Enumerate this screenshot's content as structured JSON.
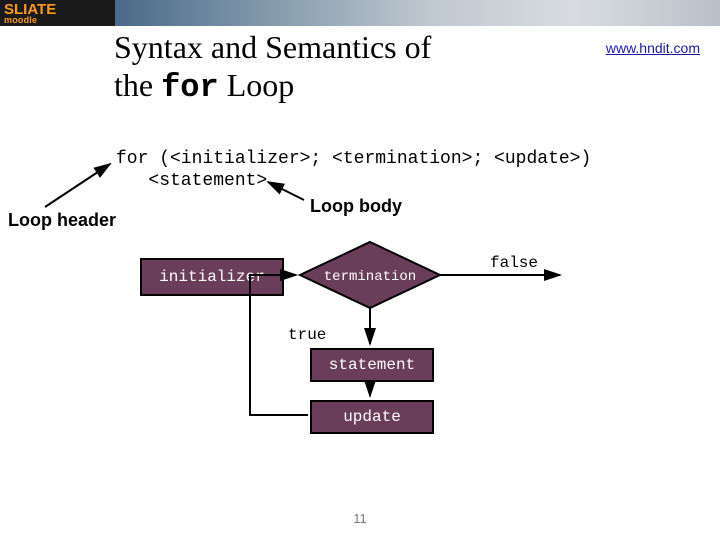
{
  "brand": {
    "line1a": "SLIATE",
    "line1b": "",
    "sub": "moodle"
  },
  "title": {
    "p1": "Syntax and Semantics of",
    "p2a": "the ",
    "keyword": "for",
    "p2b": " Loop"
  },
  "link": "www.hndit.com",
  "syntax": {
    "line1": "for (<initializer>; <termination>; <update>)",
    "line2": "   <statement>"
  },
  "labels": {
    "loop_header": "Loop header",
    "loop_body": "Loop body",
    "true": "true",
    "false": "false"
  },
  "nodes": {
    "initializer": "initializer",
    "termination": "termination",
    "statement": "statement",
    "update": "update"
  },
  "page_number": "11"
}
